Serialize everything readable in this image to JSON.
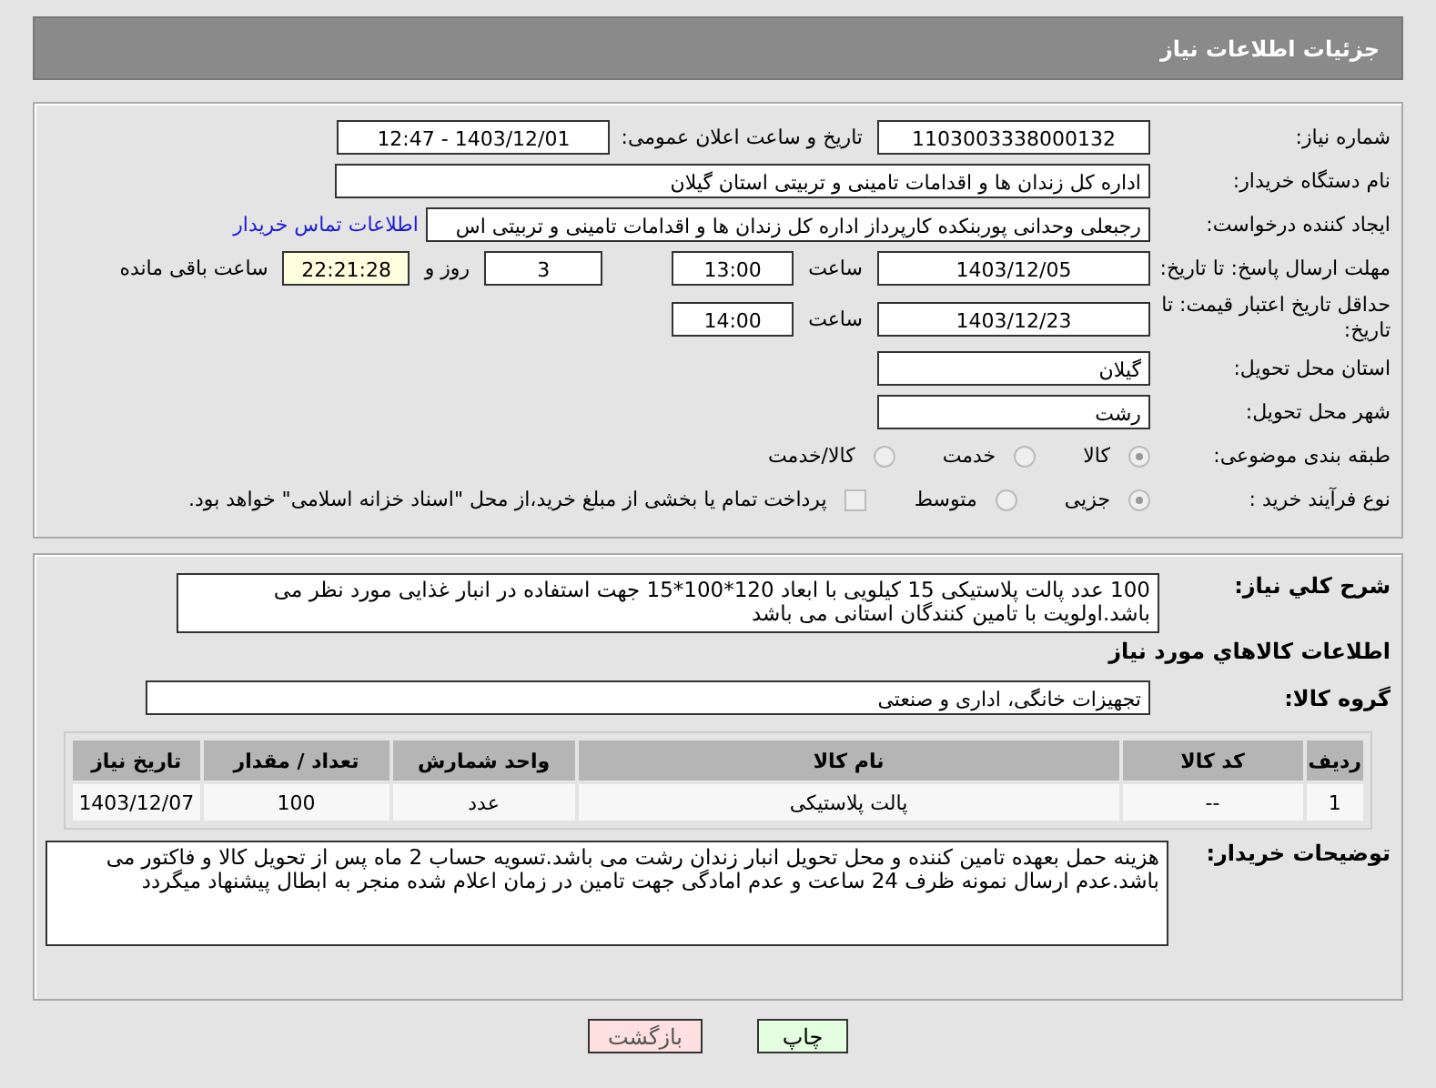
{
  "header": {
    "title": "جزئیات اطلاعات نیاز"
  },
  "need_number": {
    "label": "شماره نیاز:",
    "value": "1103003338000132"
  },
  "announce": {
    "label": "تاریخ و ساعت اعلان عمومی:",
    "value": "1403/12/01 - 12:47"
  },
  "buyer": {
    "label": "نام دستگاه خریدار:",
    "value": "اداره کل زندان ها و اقدامات تامینی و تربیتی استان گیلان"
  },
  "requester": {
    "label": "ایجاد کننده درخواست:",
    "value": "رجبعلی وحدانی پوربنکده کارپرداز اداره کل زندان ها و اقدامات تامینی و تربیتی اس",
    "link": "اطلاعات تماس خریدار"
  },
  "deadline": {
    "label": "مهلت ارسال پاسخ: تا تاریخ:",
    "date": "1403/12/05",
    "time_label": "ساعت",
    "time": "13:00",
    "days": "3",
    "days_label": "روز و",
    "remaining": "22:21:28",
    "remaining_label": "ساعت باقی مانده"
  },
  "validity": {
    "label": "حداقل تاریخ اعتبار قیمت: تا تاریخ:",
    "date": "1403/12/23",
    "time_label": "ساعت",
    "time": "14:00"
  },
  "province": {
    "label": "استان محل تحویل:",
    "value": "گیلان"
  },
  "city": {
    "label": "شهر محل تحویل:",
    "value": "رشت"
  },
  "category": {
    "label": "طبقه بندی موضوعی:",
    "options": [
      {
        "label": "کالا",
        "selected": true
      },
      {
        "label": "خدمت",
        "selected": false
      },
      {
        "label": "کالا/خدمت",
        "selected": false
      }
    ]
  },
  "process": {
    "label": "نوع فرآیند خرید :",
    "options": [
      {
        "label": "جزیی",
        "selected": true
      },
      {
        "label": "متوسط",
        "selected": false
      }
    ],
    "treasury": {
      "label": "پرداخت تمام یا بخشی از مبلغ خرید،از محل \"اسناد خزانه اسلامی\" خواهد بود.",
      "checked": false
    }
  },
  "description": {
    "label": "شرح کلي نياز:",
    "value": "100 عدد پالت پلاستیکی 15 کیلویی با ابعاد 120*100*15 جهت استفاده در انبار غذایی مورد نظر می باشد.اولویت با تامین کنندگان استانی می باشد"
  },
  "goods_title": "اطلاعات کالاهاي مورد نياز",
  "goods_group": {
    "label": "گروه کالا:",
    "value": "تجهیزات خانگی، اداری و صنعتی"
  },
  "table": {
    "columns": [
      "ردیف",
      "کد کالا",
      "نام کالا",
      "واحد شمارش",
      "تعداد / مقدار",
      "تاریخ نیاز"
    ],
    "rows": [
      [
        "1",
        "--",
        "پالت پلاستیکی",
        "عدد",
        "100",
        "1403/12/07"
      ]
    ]
  },
  "buyer_notes": {
    "label": "توضیحات خریدار:",
    "value": "هزینه حمل بعهده تامین کننده و محل تحویل انبار زندان رشت می باشد.تسویه حساب 2 ماه پس از تحویل کالا و فاکتور می باشد.عدم ارسال نمونه ظرف 24 ساعت و عدم امادگی جهت تامین در زمان اعلام شده منجر به ابطال پیشنهاد میگردد"
  },
  "buttons": [
    {
      "label": "چاپ",
      "kind": "print"
    },
    {
      "label": "بازگشت",
      "kind": "back"
    }
  ]
}
